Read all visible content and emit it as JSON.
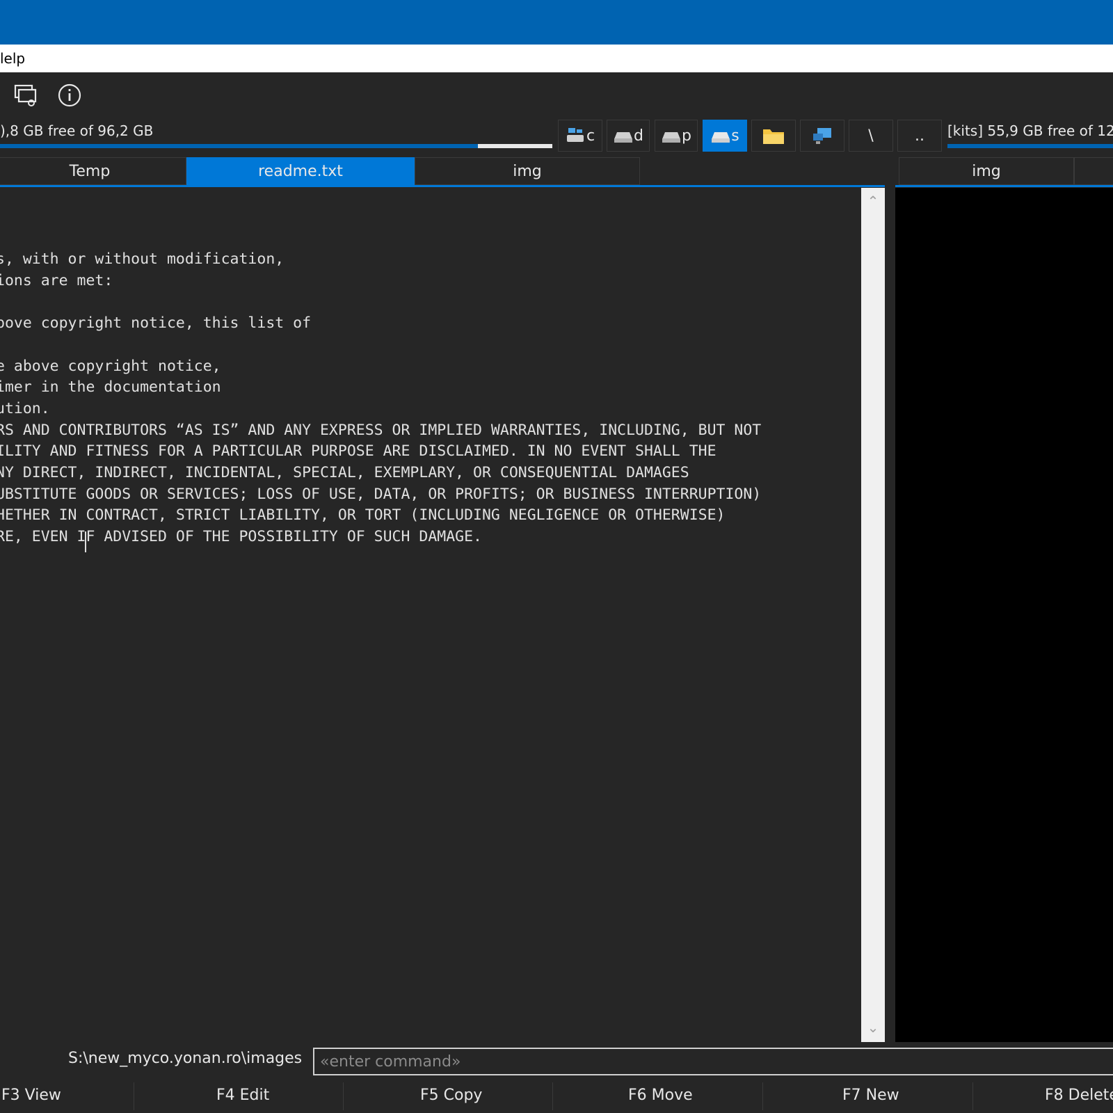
{
  "menubar": {
    "partial_label": "lelp"
  },
  "toolbar": {
    "icons": [
      "chat-settings-icon",
      "info-icon"
    ]
  },
  "left_disk": {
    "info": "),8 GB free of 96,2 GB",
    "used_fraction": 0.865
  },
  "right_disk": {
    "info": "[kits] 55,9 GB free of 12"
  },
  "drives": [
    {
      "letter": "c",
      "icon": "network-drive-icon"
    },
    {
      "letter": "d",
      "icon": "drive-icon"
    },
    {
      "letter": "p",
      "icon": "drive-icon"
    },
    {
      "letter": "s",
      "icon": "drive-icon",
      "active": true
    }
  ],
  "nav_buttons": {
    "folder_icon": "folder-icon",
    "network_icon": "network-icon",
    "root": "\\",
    "parent": ".."
  },
  "left_tabs": [
    "Temp",
    "readme.txt",
    "img"
  ],
  "right_tabs": [
    "img"
  ],
  "viewer": {
    "lines": [
      "s, with or without modification,",
      "ions are met:",
      "",
      "bove copyright notice, this list of",
      "",
      "e above copyright notice,",
      "imer in the documentation",
      "ution.",
      "RS AND CONTRIBUTORS “AS IS” AND ANY EXPRESS OR IMPLIED WARRANTIES, INCLUDING, BUT NOT",
      "ILITY AND FITNESS FOR A PARTICULAR PURPOSE ARE DISCLAIMED. IN NO EVENT SHALL THE",
      "NY DIRECT, INDIRECT, INCIDENTAL, SPECIAL, EXEMPLARY, OR CONSEQUENTIAL DAMAGES",
      "UBSTITUTE GOODS OR SERVICES; LOSS OF USE, DATA, OR PROFITS; OR BUSINESS INTERRUPTION)",
      "HETHER IN CONTRACT, STRICT LIABILITY, OR TORT (INCLUDING NEGLIGENCE OR OTHERWISE)",
      "RE, EVEN IF ADVISED OF THE POSSIBILITY OF SUCH DAMAGE."
    ]
  },
  "scrollbar": {
    "up": "⌃",
    "down": "⌄"
  },
  "command": {
    "path": "S:\\new_myco.yonan.ro\\images",
    "placeholder": "«enter command»"
  },
  "function_keys": [
    "F3 View",
    "F4 Edit",
    "F5 Copy",
    "F6 Move",
    "F7 New",
    "F8 Delete"
  ]
}
